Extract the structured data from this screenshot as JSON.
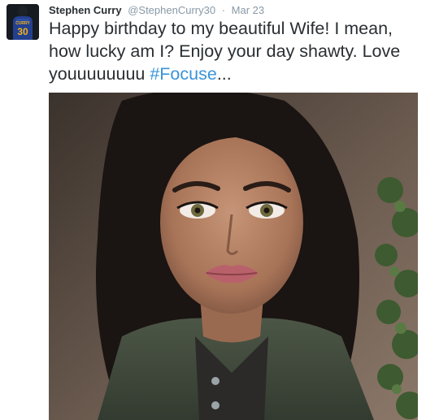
{
  "tweet": {
    "author": {
      "name": "Stephen Curry",
      "handle": "@StephenCurry30",
      "avatar_jersey_number": "30"
    },
    "separator": "·",
    "date": "Mar 23",
    "text_main": "Happy birthday to my beautiful Wife! I mean, how lucky am I? Enjoy your day shawty. Love youuuuuuuu ",
    "hashtag": "#Focuse",
    "ellipsis": "...",
    "colors": {
      "link": "#3b94d9",
      "text": "#292f33",
      "muted": "#8899a6",
      "jersey_gold": "#f2b21c"
    }
  }
}
